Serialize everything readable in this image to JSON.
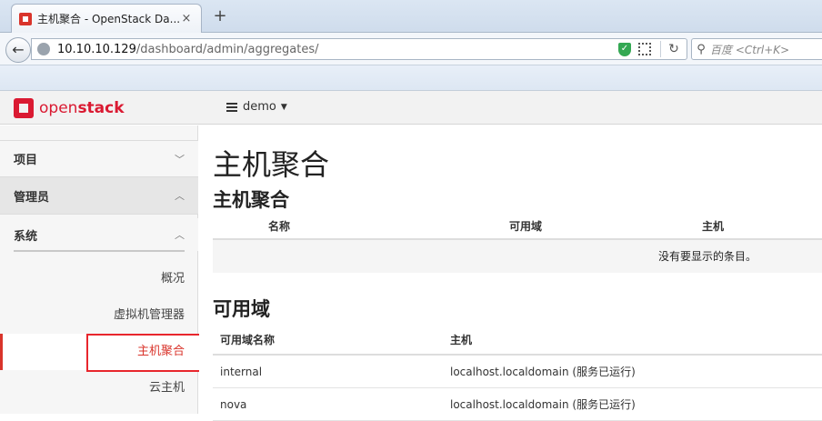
{
  "browser": {
    "tab_title": "主机聚合 - OpenStack Da...",
    "tab_close": "×",
    "new_tab": "+",
    "url_host": "10.10.10.129",
    "url_path": "/dashboard/admin/aggregates/",
    "search_placeholder": "百度 <Ctrl+K>"
  },
  "header": {
    "logo_part1": "open",
    "logo_part2": "stack",
    "project": "demo"
  },
  "sidebar": {
    "project": "项目",
    "admin": "管理员",
    "system": "系统",
    "items": [
      {
        "label": "概况"
      },
      {
        "label": "虚拟机管理器"
      },
      {
        "label": "主机聚合"
      },
      {
        "label": "云主机"
      }
    ]
  },
  "main": {
    "page_title": "主机聚合",
    "aggregates": {
      "heading": "主机聚合",
      "columns": [
        "名称",
        "可用域",
        "主机"
      ],
      "empty_message": "没有要显示的条目。"
    },
    "zones": {
      "heading": "可用域",
      "columns": [
        "可用域名称",
        "主机"
      ],
      "rows": [
        {
          "name": "internal",
          "hosts": "localhost.localdomain (服务已运行)"
        },
        {
          "name": "nova",
          "hosts": "localhost.localdomain (服务已运行)"
        }
      ]
    }
  }
}
